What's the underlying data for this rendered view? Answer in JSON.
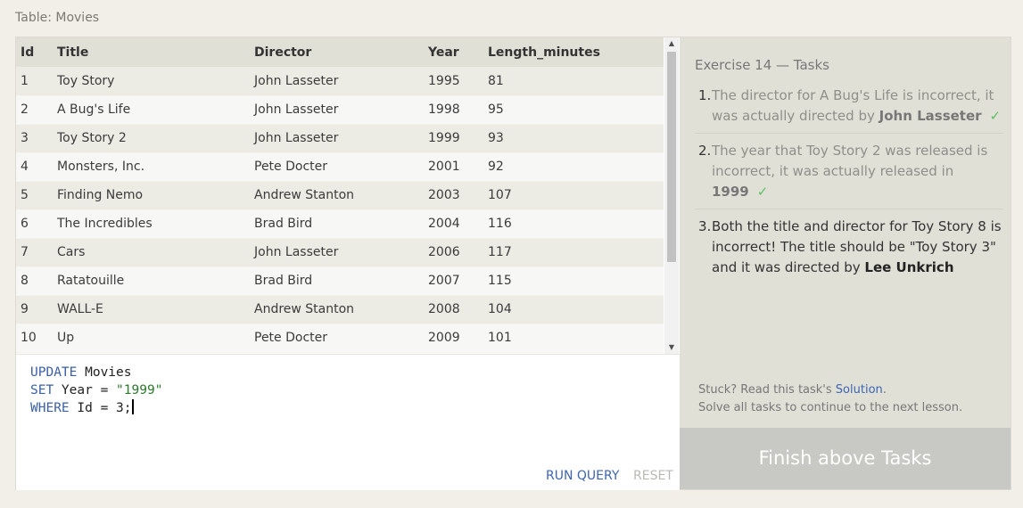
{
  "table_caption": "Table: Movies",
  "table": {
    "columns": [
      "Id",
      "Title",
      "Director",
      "Year",
      "Length_minutes"
    ],
    "rows": [
      [
        "1",
        "Toy Story",
        "John Lasseter",
        "1995",
        "81"
      ],
      [
        "2",
        "A Bug's Life",
        "John Lasseter",
        "1998",
        "95"
      ],
      [
        "3",
        "Toy Story 2",
        "John Lasseter",
        "1999",
        "93"
      ],
      [
        "4",
        "Monsters, Inc.",
        "Pete Docter",
        "2001",
        "92"
      ],
      [
        "5",
        "Finding Nemo",
        "Andrew Stanton",
        "2003",
        "107"
      ],
      [
        "6",
        "The Incredibles",
        "Brad Bird",
        "2004",
        "116"
      ],
      [
        "7",
        "Cars",
        "John Lasseter",
        "2006",
        "117"
      ],
      [
        "8",
        "Ratatouille",
        "Brad Bird",
        "2007",
        "115"
      ],
      [
        "9",
        "WALL-E",
        "Andrew Stanton",
        "2008",
        "104"
      ],
      [
        "10",
        "Up",
        "Pete Docter",
        "2009",
        "101"
      ]
    ]
  },
  "editor": {
    "line1_kw": "UPDATE",
    "line1_rest": " Movies",
    "line2_kw": "SET",
    "line2_mid": " Year = ",
    "line2_str": "\"1999\"",
    "line3_kw": "WHERE",
    "line3_rest": " Id = 3;",
    "run_label": "RUN QUERY",
    "reset_label": "RESET"
  },
  "tasks": {
    "title": "Exercise 14 — Tasks",
    "items": [
      {
        "num": "1.",
        "text": "The director for A Bug's Life is incorrect, it was actually directed by ",
        "em": "John Lasseter",
        "check": "✓",
        "status": "done"
      },
      {
        "num": "2.",
        "text": "The year that Toy Story 2 was released is incorrect, it was actually released in ",
        "em": "1999",
        "check": "✓",
        "status": "done"
      },
      {
        "num": "3.",
        "text": "Both the title and director for Toy Story 8 is incorrect! The title should be \"Toy Story 3\" and it was directed by ",
        "em": "Lee Unkrich",
        "status": "active"
      }
    ],
    "stuck_prefix": "Stuck? Read this task's ",
    "solution_link": "Solution",
    "stuck_suffix": ".",
    "continue_text": "Solve all tasks to continue to the next lesson.",
    "finish_label": "Finish above Tasks"
  },
  "colors": {
    "accent_link": "#3c65b3",
    "check_green": "#5fbf66",
    "finish_bg": "#c8c8c4"
  }
}
